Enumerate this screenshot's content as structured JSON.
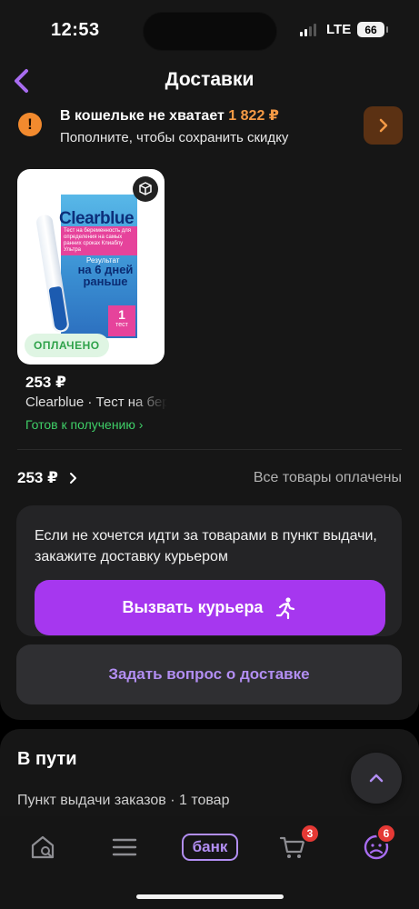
{
  "status_bar": {
    "time": "12:53",
    "network": "LTE",
    "battery": "66"
  },
  "header": {
    "title": "Доставки"
  },
  "warning": {
    "title": "В кошельке не хватает",
    "amount": "1 822 ₽",
    "subtitle": "Пополните, чтобы сохранить скидку"
  },
  "product": {
    "image_brand": "Clearblue",
    "image_pink_text": "Тест на беременность для определения на самых ранних сроках Клиаблу Ультра",
    "image_result": "Результат",
    "image_big_text": "на 6 дней раньше",
    "image_count": "1",
    "image_count_label": "тест",
    "paid_badge": "ОПЛАЧЕНО",
    "price": "253 ₽",
    "name": "Clearblue · Тест на беременность",
    "status": "Готов к получению ›"
  },
  "summary": {
    "total": "253 ₽",
    "all_paid": "Все товары оплачены"
  },
  "courier": {
    "text": "Если не хочется идти за товарами в пункт выдачи, закажите доставку курьером",
    "button": "Вызвать курьера"
  },
  "ask_button": "Задать вопрос о доставке",
  "on_the_way": {
    "title": "В пути",
    "subtitle": "Пункт выдачи заказов · 1 товар"
  },
  "tabbar": {
    "bank_label": "банк",
    "cart_badge": "3",
    "profile_badge": "6"
  },
  "colors": {
    "accent": "#a637ef",
    "warning": "#f28a2e",
    "success": "#3fcf68",
    "badge": "#e53935"
  }
}
